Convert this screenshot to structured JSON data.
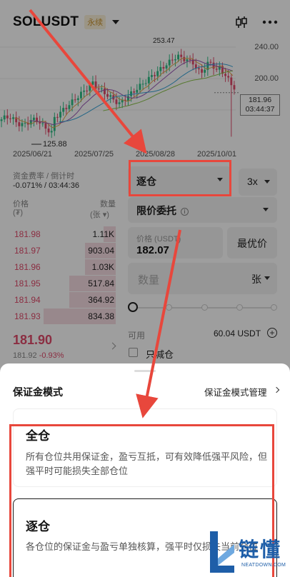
{
  "header": {
    "symbol": "SOLUSDT",
    "badge": "永续"
  },
  "chart_data": {
    "type": "candlestick",
    "y_ticks": [
      "240.00",
      "200.00"
    ],
    "x_ticks": [
      "2025/06/21",
      "2025/07/25",
      "2025/08/28",
      "2025/10/01"
    ],
    "last_price": "181.96",
    "countdown": "03:44:37",
    "low_label": "125.88",
    "high_label": "253.47",
    "colors": {
      "up": "#2ebd85",
      "down": "#e14b6b"
    }
  },
  "funding": {
    "label": "资金费率 / 倒计时",
    "value": "-0.071% / 03:44:36"
  },
  "orderbook": {
    "price_header": "价格",
    "price_unit": "(₮)",
    "qty_header": "数量",
    "qty_unit": "(张 ▾)",
    "asks": [
      {
        "price": "181.98",
        "qty": "1.11K",
        "depth": 0.12
      },
      {
        "price": "181.97",
        "qty": "903.04",
        "depth": 0.3
      },
      {
        "price": "181.96",
        "qty": "1.03K",
        "depth": 0.3
      },
      {
        "price": "181.95",
        "qty": "517.84",
        "depth": 0.45
      },
      {
        "price": "181.94",
        "qty": "364.92",
        "depth": 0.45
      },
      {
        "price": "181.93",
        "qty": "834.38",
        "depth": 0.7
      }
    ],
    "last_price": "181.90",
    "mark_price": "181.92",
    "change": "-0.93%"
  },
  "form": {
    "margin_mode": "逐仓",
    "leverage": "3x",
    "order_type": "限价委托",
    "price_label": "价格 (USDT)",
    "price_value": "182.07",
    "best_price": "最优价",
    "qty_placeholder": "数量",
    "qty_unit": "张",
    "available_label": "可用",
    "available_value": "60.04 USDT",
    "reduce_only": "只减仓"
  },
  "sheet": {
    "title": "保证金模式",
    "manage_link": "保证金模式管理",
    "cross_title": "全仓",
    "cross_desc": "所有仓位共用保证金，盈亏互抵，可有效降低强平风险，但强平时可能损失全部仓位",
    "isolated_title": "逐仓",
    "isolated_desc": "各仓位的保证金与盈亏单独核算，强平时仅损失当前仓位"
  },
  "watermark": {
    "text": "链懂",
    "sub": "NEATDOWN.COM"
  }
}
